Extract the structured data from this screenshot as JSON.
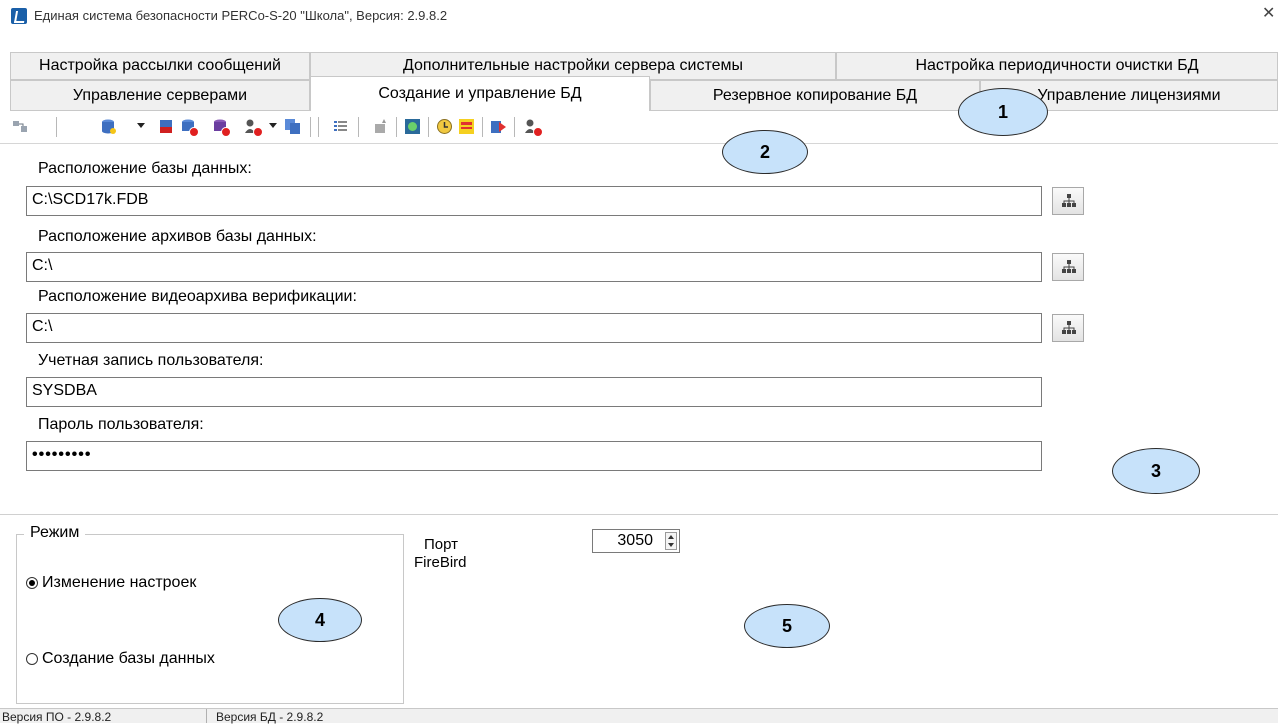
{
  "window": {
    "title": "Единая система безопасности PERCo-S-20 \"Школа\", Версия: 2.9.8.2",
    "close_glyph": "✕"
  },
  "tabs": {
    "row1": [
      {
        "label": "Настройка рассылки сообщений"
      },
      {
        "label": "Дополнительные настройки сервера системы"
      },
      {
        "label": "Настройка периодичности  очистки БД"
      }
    ],
    "row2": [
      {
        "label": "Управление серверами"
      },
      {
        "label": "Создание и управление БД",
        "active": true
      },
      {
        "label": "Резервное копирование БД"
      },
      {
        "label": "Управление лицензиями"
      }
    ]
  },
  "toolbar": {
    "icons": [
      "connect-icon",
      "database-dropdown-icon",
      "database-red-icon",
      "database-delete-icon",
      "database-stop-icon",
      "user-delete-dropdown-icon",
      "database-copy-icon",
      "properties-icon",
      "wizard-icon",
      "refresh-icon",
      "clock-icon",
      "calendar-icon",
      "export-icon",
      "user-remove-icon"
    ]
  },
  "form": {
    "db_location_label": "Расположение базы данных:",
    "db_location_value": "C:\\SCD17k.FDB",
    "archive_location_label": "Расположение архивов базы данных:",
    "archive_location_value": "C:\\",
    "video_archive_label": "Расположение видеоархива верификации:",
    "video_archive_value": "C:\\",
    "user_account_label": "Учетная запись пользователя:",
    "user_account_value": "SYSDBA",
    "password_label": "Пароль пользователя:",
    "password_value": "•••••••••"
  },
  "mode": {
    "title": "Режим",
    "options": [
      {
        "label": "Изменение настроек",
        "selected": true
      },
      {
        "label": "Создание базы данных",
        "selected": false
      }
    ]
  },
  "port": {
    "label_line1": "Порт",
    "label_line2": "FireBird",
    "value": "3050"
  },
  "callouts": [
    "1",
    "2",
    "3",
    "4",
    "5"
  ],
  "status": {
    "software_version": "Версия ПО - 2.9.8.2",
    "db_version": "Версия БД - 2.9.8.2"
  }
}
